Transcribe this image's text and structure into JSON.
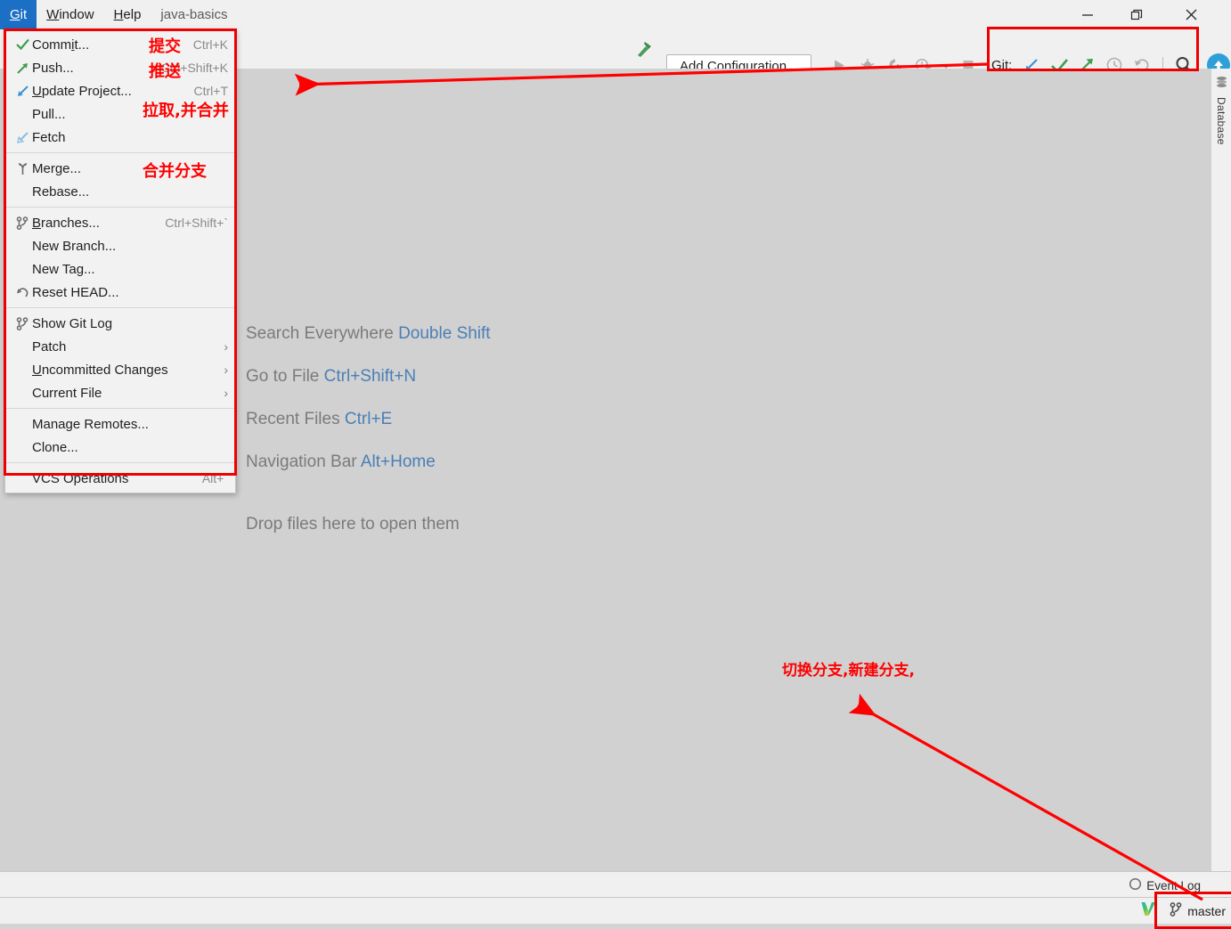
{
  "window": {
    "title_project": "java-basics",
    "controls": [
      {
        "name": "minimize",
        "glyph": "minimize-icon"
      },
      {
        "name": "maximize",
        "glyph": "restore-icon"
      },
      {
        "name": "close",
        "glyph": "close-icon"
      }
    ]
  },
  "menubar": {
    "items": [
      {
        "label": "Git",
        "mnemonic": "G",
        "selected": true
      },
      {
        "label": "Window",
        "mnemonic": "W",
        "selected": false
      },
      {
        "label": "Help",
        "mnemonic": "H",
        "selected": false
      }
    ]
  },
  "toolbar": {
    "build_icon": "hammer-icon",
    "add_configuration": "Add Configuration...",
    "run_icons": [
      "run-icon",
      "debug-icon",
      "run-with-coverage-icon",
      "profile-icon",
      "chevron-down-icon",
      "stop-icon"
    ],
    "git_label": "Git:",
    "git_actions": [
      {
        "name": "update-project-icon",
        "tooltip": "Update Project"
      },
      {
        "name": "commit-icon",
        "tooltip": "Commit"
      },
      {
        "name": "push-icon",
        "tooltip": "Push"
      },
      {
        "name": "history-icon",
        "tooltip": "Show History"
      },
      {
        "name": "rollback-icon",
        "tooltip": "Rollback"
      },
      {
        "name": "search-icon",
        "tooltip": "Search Everywhere"
      }
    ],
    "update_button_icon": "arrow-up-circle-icon"
  },
  "git_menu": {
    "groups": [
      [
        {
          "icon": "commit-check-icon",
          "label": "Commit...",
          "mnemonic": "i",
          "shortcut": "Ctrl+K",
          "submenu": false
        },
        {
          "icon": "push-arrow-icon",
          "label": "Push...",
          "mnemonic": "",
          "shortcut": "Ctrl+Shift+K",
          "submenu": false
        },
        {
          "icon": "update-arrow-icon",
          "label": "Update Project...",
          "mnemonic": "U",
          "shortcut": "Ctrl+T",
          "submenu": false
        },
        {
          "icon": "none",
          "label": "Pull...",
          "mnemonic": "",
          "shortcut": "",
          "submenu": false
        },
        {
          "icon": "fetch-arrow-icon",
          "label": "Fetch",
          "mnemonic": "",
          "shortcut": "",
          "submenu": false
        }
      ],
      [
        {
          "icon": "merge-icon",
          "label": "Merge...",
          "mnemonic": "",
          "shortcut": "",
          "submenu": false
        },
        {
          "icon": "none",
          "label": "Rebase...",
          "mnemonic": "",
          "shortcut": "",
          "submenu": false
        }
      ],
      [
        {
          "icon": "branch-icon",
          "label": "Branches...",
          "mnemonic": "B",
          "shortcut": "Ctrl+Shift+`",
          "submenu": false
        },
        {
          "icon": "none",
          "label": "New Branch...",
          "mnemonic": "",
          "shortcut": "",
          "submenu": false
        },
        {
          "icon": "none",
          "label": "New Tag...",
          "mnemonic": "",
          "shortcut": "",
          "submenu": false
        },
        {
          "icon": "reset-head-icon",
          "label": "Reset HEAD...",
          "mnemonic": "",
          "shortcut": "",
          "submenu": false
        }
      ],
      [
        {
          "icon": "git-log-icon",
          "label": "Show Git Log",
          "mnemonic": "",
          "shortcut": "",
          "submenu": false
        },
        {
          "icon": "none",
          "label": "Patch",
          "mnemonic": "",
          "shortcut": "",
          "submenu": true
        },
        {
          "icon": "none",
          "label": "Uncommitted Changes",
          "mnemonic": "U",
          "shortcut": "",
          "submenu": true
        },
        {
          "icon": "none",
          "label": "Current File",
          "mnemonic": "",
          "shortcut": "",
          "submenu": true
        }
      ],
      [
        {
          "icon": "none",
          "label": "Manage Remotes...",
          "mnemonic": "",
          "shortcut": "",
          "submenu": false
        },
        {
          "icon": "none",
          "label": "Clone...",
          "mnemonic": "",
          "shortcut": "",
          "submenu": false
        }
      ],
      [
        {
          "icon": "none",
          "label": "VCS Operations",
          "mnemonic": "",
          "shortcut": "Alt+`",
          "submenu": false
        }
      ]
    ]
  },
  "editor": {
    "shortcuts": [
      {
        "action": "Search Everywhere",
        "key": "Double Shift"
      },
      {
        "action": "Go to File",
        "key": "Ctrl+Shift+N"
      },
      {
        "action": "Recent Files",
        "key": "Ctrl+E"
      },
      {
        "action": "Navigation Bar",
        "key": "Alt+Home"
      }
    ],
    "drop_hint": "Drop files here to open them"
  },
  "right_strip": {
    "database_tab": "Database",
    "database_icon": "database-icon"
  },
  "bottom": {
    "event_log": "Event Log",
    "event_log_icon": "event-log-icon",
    "validation_icon": "idea-v-icon",
    "branch_icon": "branch-icon",
    "branch": "master"
  },
  "annotations": {
    "color": "#ff0000",
    "notes": [
      {
        "id": "commit",
        "text": "提交"
      },
      {
        "id": "push",
        "text": "推送"
      },
      {
        "id": "pull",
        "text": "拉取,并合并"
      },
      {
        "id": "merge",
        "text": "合并分支"
      },
      {
        "id": "branch",
        "text": "切换分支,新建分支,"
      }
    ],
    "boxes": [
      "git-menu-box",
      "git-toolbar-box",
      "branch-widget-box"
    ],
    "arrows": [
      "git-toolbar-arrow",
      "branch-widget-arrow"
    ]
  }
}
